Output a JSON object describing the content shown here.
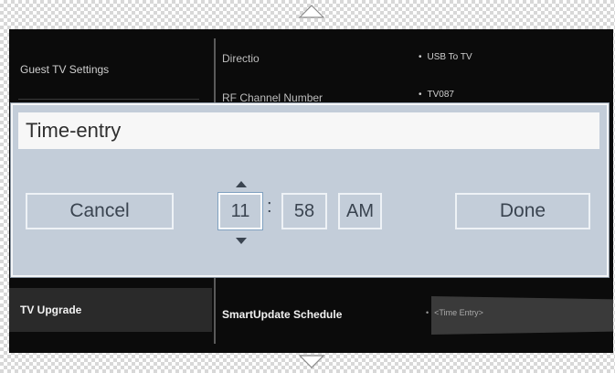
{
  "sidebar": {
    "items": [
      {
        "label": "Guest TV Settings"
      },
      {
        "label": "TV Upgrade"
      }
    ]
  },
  "settings": {
    "rows": [
      {
        "label": "Directio",
        "value": "USB To TV"
      },
      {
        "label": "RF Channel Number",
        "value": "TV087"
      },
      {
        "label": "SmartUpdate Schedule",
        "value": "<Time Entry>"
      }
    ]
  },
  "dialog": {
    "title": "Time-entry",
    "cancel_label": "Cancel",
    "done_label": "Done",
    "hour": "11",
    "separator": ":",
    "minute": "58",
    "ampm": "AM"
  },
  "icons": {
    "top": "scroll-up-icon",
    "bottom": "scroll-down-icon",
    "spin_up": "caret-up-icon",
    "spin_down": "caret-down-icon"
  },
  "colors": {
    "dialog_bg": "#c3cdd9",
    "screen_bg": "#0b0b0b",
    "focus": "#7fa0c0"
  }
}
